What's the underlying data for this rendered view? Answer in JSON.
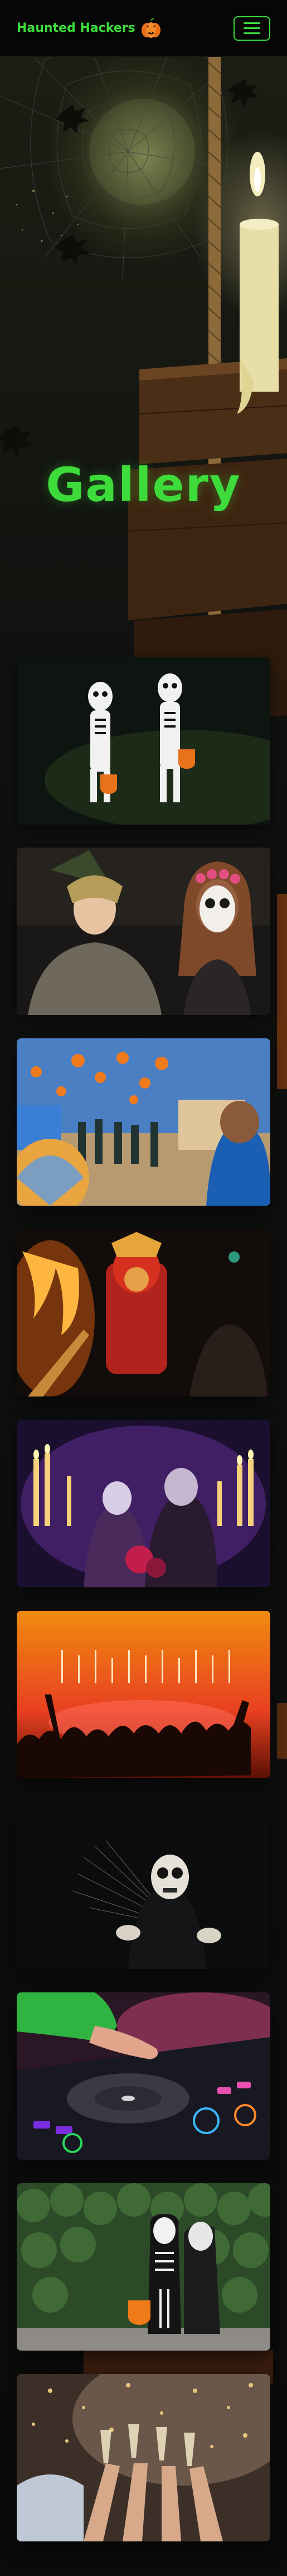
{
  "navbar": {
    "brand": "Haunted Hackers",
    "brand_icon": "pumpkin-icon",
    "menu_icon": "hamburger-menu-icon"
  },
  "hero": {
    "title": "Gallery"
  },
  "gallery": {
    "items": [
      {
        "subject": "two children in skeleton costumes holding pumpkin buckets"
      },
      {
        "subject": "woman in witch hat beside person with sugar skull face paint and flower crown"
      },
      {
        "subject": "street festival with orange balloons and crowd"
      },
      {
        "subject": "costumed figure with flaming torches at night"
      },
      {
        "subject": "performers with candles in purple haunted scene"
      },
      {
        "subject": "concert crowd under orange and red stage lights"
      },
      {
        "subject": "person in skeleton mask with spider web"
      },
      {
        "subject": "DJ hands on turntable with colorful lights"
      },
      {
        "subject": "two kids in skeleton costumes in front of a hedge"
      },
      {
        "subject": "hands raising champagne glasses with confetti"
      }
    ]
  },
  "colors": {
    "accent": "#3ddc3a",
    "background": "#0b0d0c",
    "navbar": "#060606"
  }
}
